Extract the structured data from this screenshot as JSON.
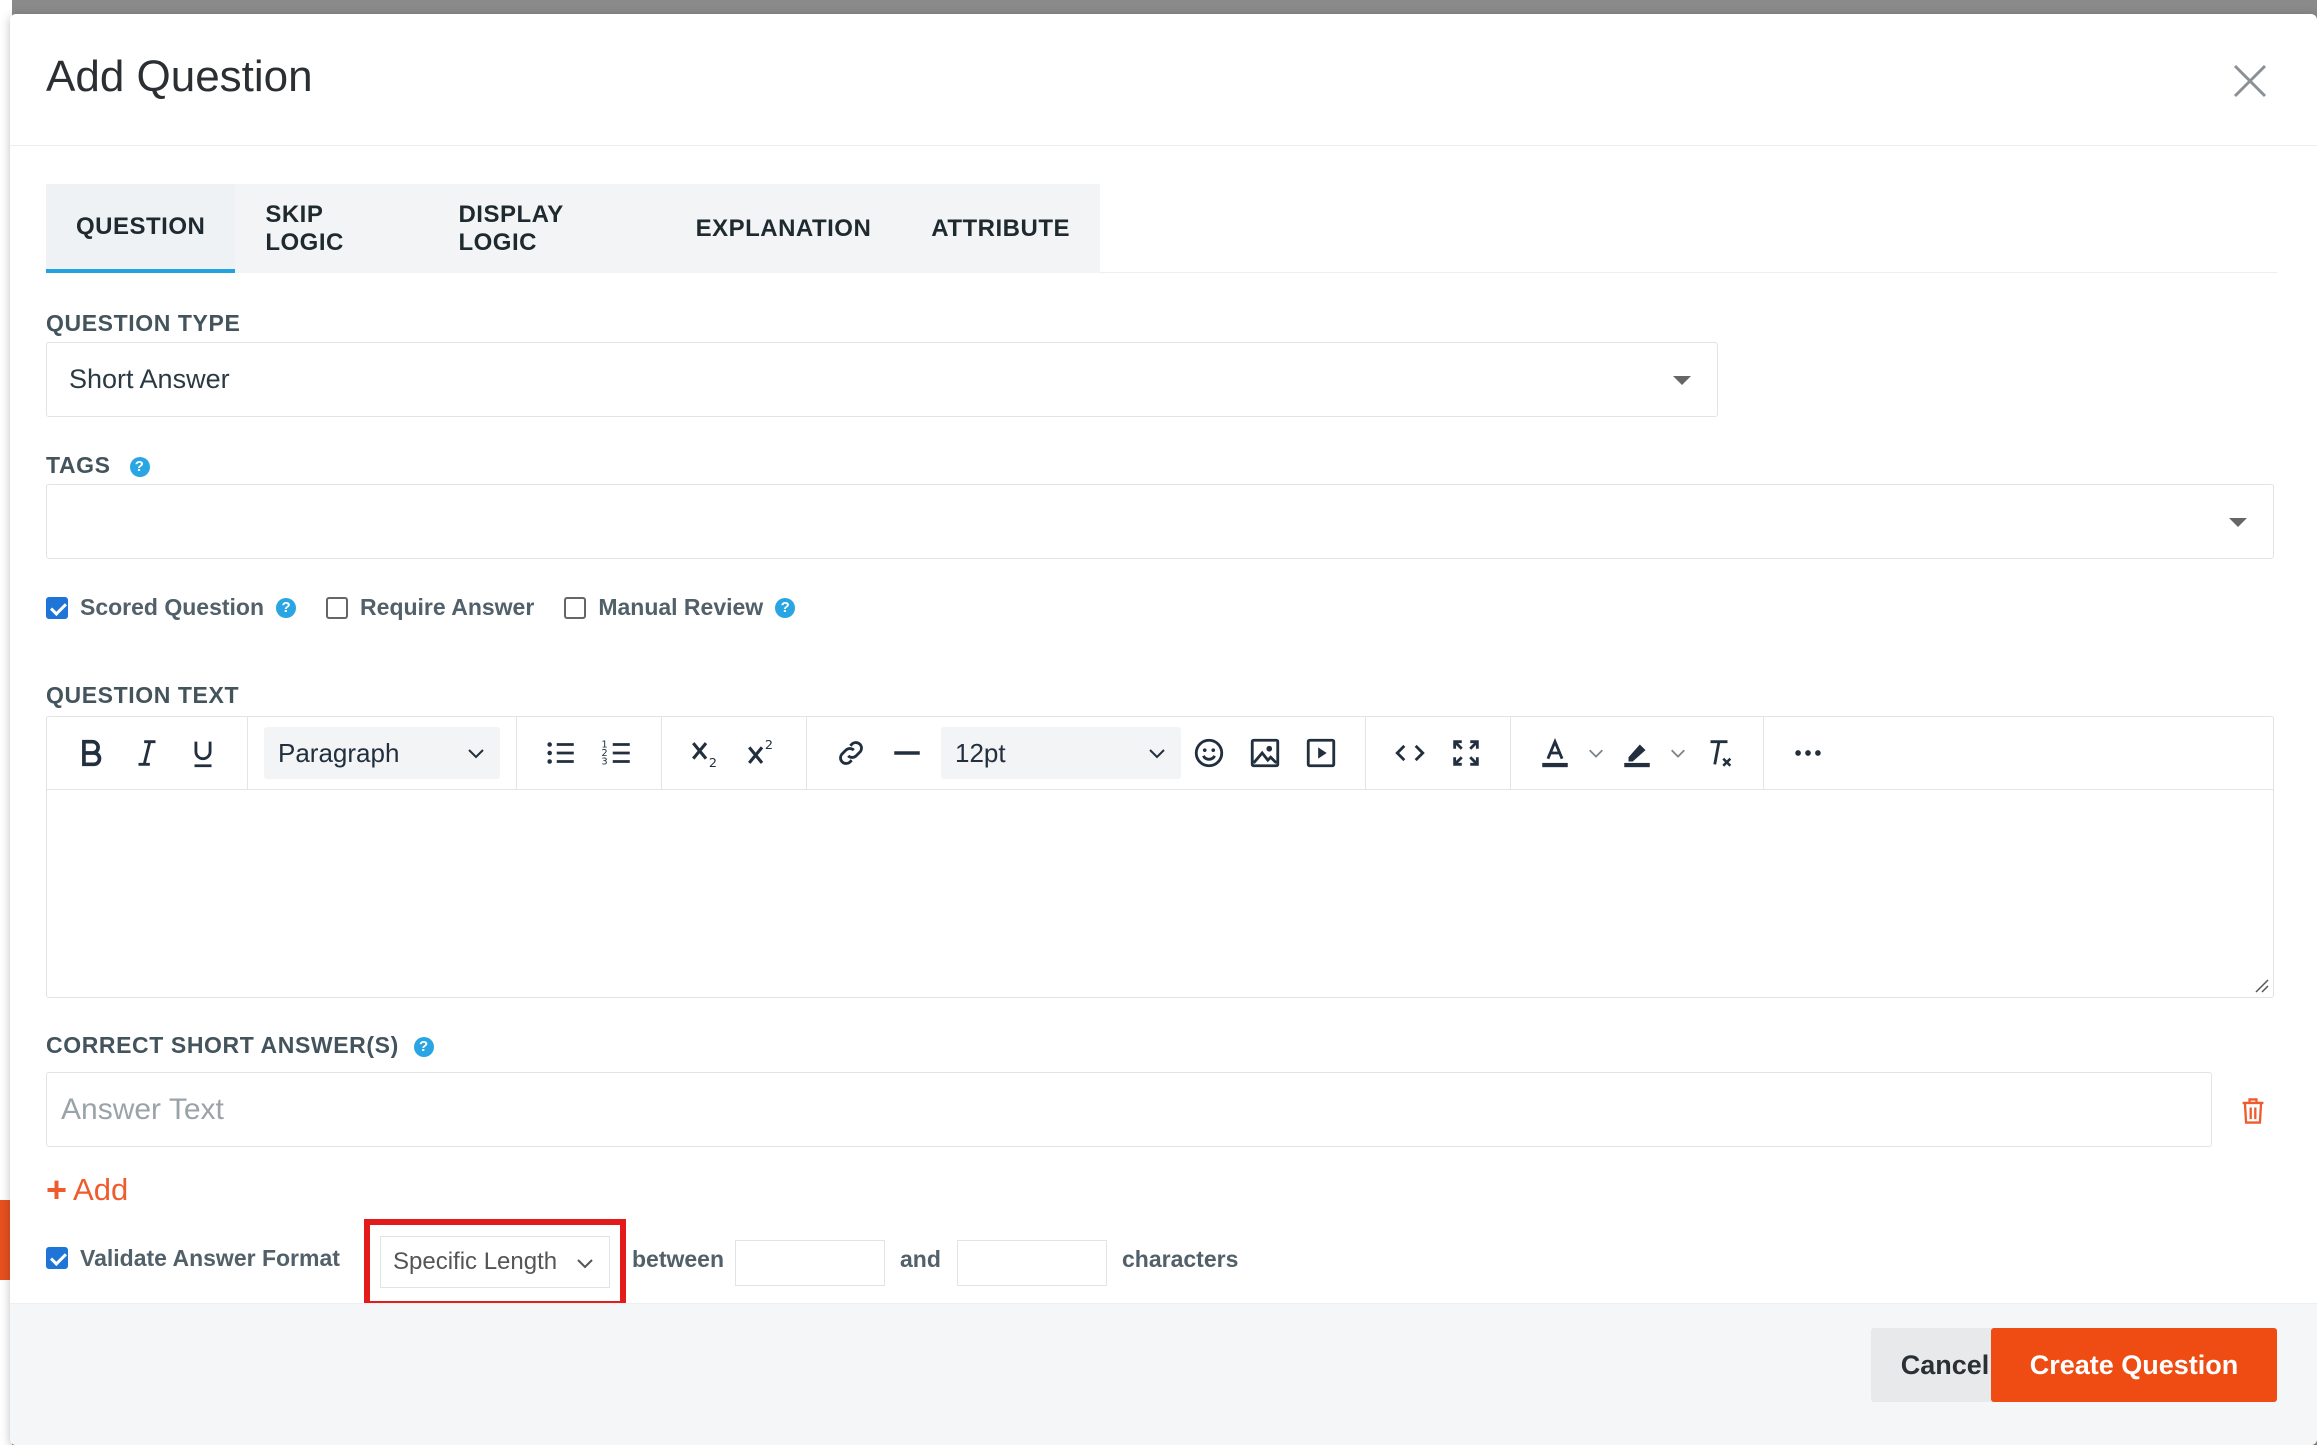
{
  "modal": {
    "title": "Add Question"
  },
  "tabs": [
    {
      "label": "QUESTION",
      "active": true
    },
    {
      "label": "SKIP LOGIC",
      "active": false
    },
    {
      "label": "DISPLAY LOGIC",
      "active": false
    },
    {
      "label": "EXPLANATION",
      "active": false
    },
    {
      "label": "ATTRIBUTE",
      "active": false
    }
  ],
  "question_type": {
    "label": "QUESTION TYPE",
    "value": "Short Answer"
  },
  "tags": {
    "label": "TAGS",
    "value": ""
  },
  "options": {
    "scored_question": {
      "label": "Scored Question",
      "checked": true
    },
    "require_answer": {
      "label": "Require Answer",
      "checked": false
    },
    "manual_review": {
      "label": "Manual Review",
      "checked": false
    }
  },
  "question_text": {
    "label": "QUESTION TEXT",
    "block_format": "Paragraph",
    "font_size": "12pt",
    "content": ""
  },
  "correct_answers": {
    "label": "CORRECT SHORT ANSWER(S)",
    "placeholder": "Answer Text",
    "add_label": "Add"
  },
  "validation": {
    "label": "Validate Answer Format",
    "checked": true,
    "format": "Specific Length",
    "between_label": "between",
    "and_label": "and",
    "characters_label": "characters",
    "min": "",
    "max": ""
  },
  "footer": {
    "cancel_label": "Cancel",
    "create_label": "Create Question"
  },
  "colors": {
    "accent_blue": "#23a2e0",
    "primary_orange": "#ee4c13",
    "highlight_red": "#e41b1b"
  }
}
